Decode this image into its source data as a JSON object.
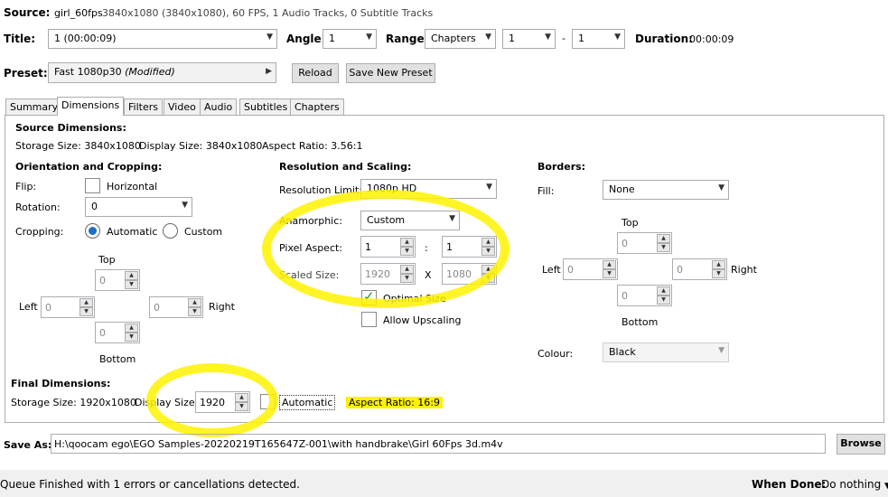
{
  "source": {
    "label": "Source:",
    "name": "girl_60fps",
    "info": "3840x1080 (3840x1080), 60 FPS, 1 Audio Tracks, 0 Subtitle Tracks"
  },
  "title_row": {
    "title_label": "Title:",
    "title_value": "1 (00:00:09)",
    "angle_label": "Angle:",
    "angle_value": "1",
    "range_label": "Range:",
    "range_type": "Chapters",
    "range_start": "1",
    "range_sep": "-",
    "range_end": "1",
    "duration_label": "Duration:",
    "duration_value": "00:00:09"
  },
  "preset": {
    "label": "Preset:",
    "name": "Fast 1080p30",
    "modified": "(Modified)",
    "reload": "Reload",
    "save_new": "Save New Preset"
  },
  "tabs": [
    "Summary",
    "Dimensions",
    "Filters",
    "Video",
    "Audio",
    "Subtitles",
    "Chapters"
  ],
  "source_dimensions": {
    "heading": "Source Dimensions:",
    "storage": "Storage Size: 3840x1080",
    "display": "Display Size: 3840x1080",
    "aspect": "Aspect Ratio: 3.56:1"
  },
  "orientation": {
    "heading": "Orientation and Cropping:",
    "flip_label": "Flip:",
    "flip_option": "Horizontal",
    "rotation_label": "Rotation:",
    "rotation_value": "0",
    "cropping_label": "Cropping:",
    "crop_automatic": "Automatic",
    "crop_custom": "Custom",
    "top_label": "Top",
    "left_label": "Left",
    "right_label": "Right",
    "bottom_label": "Bottom",
    "top": "0",
    "left": "0",
    "right": "0",
    "bottom": "0"
  },
  "resolution": {
    "heading": "Resolution and Scaling:",
    "limit_label": "Resolution Limit:",
    "limit_value": "1080p HD",
    "anamorphic_label": "Anamorphic:",
    "anamorphic_value": "Custom",
    "pixel_aspect_label": "Pixel Aspect:",
    "pixel_aspect_w": "1",
    "pixel_aspect_sep": ":",
    "pixel_aspect_h": "1",
    "scaled_label": "Scaled Size:",
    "scaled_w": "1920",
    "scaled_sep": "X",
    "scaled_h": "1080",
    "optimal_size": "Optimal Size",
    "allow_upscaling": "Allow Upscaling"
  },
  "borders": {
    "heading": "Borders:",
    "fill_label": "Fill:",
    "fill_value": "None",
    "top_label": "Top",
    "left_label": "Left",
    "right_label": "Right",
    "bottom_label": "Bottom",
    "top": "0",
    "left": "0",
    "right": "0",
    "bottom": "0",
    "colour_label": "Colour:",
    "colour_value": "Black"
  },
  "final_dimensions": {
    "heading": "Final Dimensions:",
    "storage": "Storage Size: 1920x1080",
    "display_label": "Display Size:",
    "display_value": "1920",
    "automatic": "Automatic",
    "aspect": "Aspect Ratio: 16:9"
  },
  "save_as": {
    "label": "Save As:",
    "path": "H:\\qoocam ego\\EGO Samples-20220219T165647Z-001\\with handbrake\\Girl 60Fps 3d.m4v",
    "browse": "Browse"
  },
  "status": {
    "message": "Queue Finished with 1 errors or cancellations detected.",
    "when_done_label": "When Done:",
    "when_done_value": "Do nothing"
  },
  "colors": {
    "highlight": "#fff200",
    "radio_selected": "#1e6ec8",
    "check_green": "#2a8a2a"
  }
}
